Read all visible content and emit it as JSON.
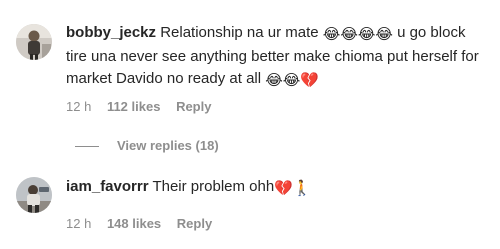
{
  "comments": [
    {
      "username": "bobby_jeckz",
      "text_part1": "Relationship na ur mate ",
      "emojis_1": "😂😂😂😂",
      "text_part2": " u go block tire una never see anything better make chioma put herself for market Davido no ready at all ",
      "emojis_2": "😂😂💔",
      "time": "12 h",
      "likes": "112 likes",
      "reply": "Reply",
      "view_replies": "View replies (18)"
    },
    {
      "username": "iam_favorrr",
      "text": "Their problem ohh",
      "emojis": "💔🚶",
      "time": "12 h",
      "likes": "148 likes",
      "reply": "Reply"
    }
  ],
  "colors": {
    "text": "#262626",
    "secondary": "#8e8e8e",
    "background": "#ffffff"
  }
}
